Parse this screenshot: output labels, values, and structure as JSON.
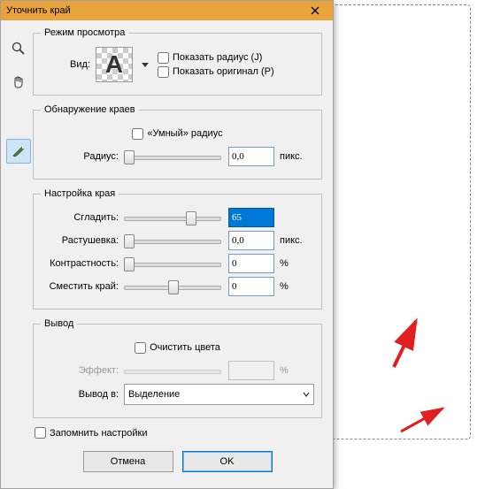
{
  "window": {
    "title": "Уточнить край"
  },
  "view": {
    "legend": "Режим просмотра",
    "vid_label": "Вид:",
    "thumb_letter": "A",
    "show_radius": "Показать радиус (J)",
    "show_original": "Показать оригинал (P)"
  },
  "edge": {
    "legend": "Обнаружение краев",
    "smart": "«Умный» радиус",
    "radius_label": "Радиус:",
    "radius_value": "0,0",
    "radius_unit": "пикс."
  },
  "adjust": {
    "legend": "Настройка края",
    "smooth_label": "Сгладить:",
    "smooth_value": "65",
    "feather_label": "Растушевка:",
    "feather_value": "0,0",
    "feather_unit": "пикс.",
    "contrast_label": "Контрастность:",
    "contrast_value": "0",
    "contrast_unit": "%",
    "shift_label": "Сместить край:",
    "shift_value": "0",
    "shift_unit": "%"
  },
  "output": {
    "legend": "Вывод",
    "decontaminate": "Очистить цвета",
    "effect_label": "Эффект:",
    "effect_unit": "%",
    "output_to_label": "Вывод в:",
    "output_to_value": "Выделение"
  },
  "footer": {
    "remember": "Запомнить настройки",
    "cancel": "Отмена",
    "ok": "OK"
  }
}
